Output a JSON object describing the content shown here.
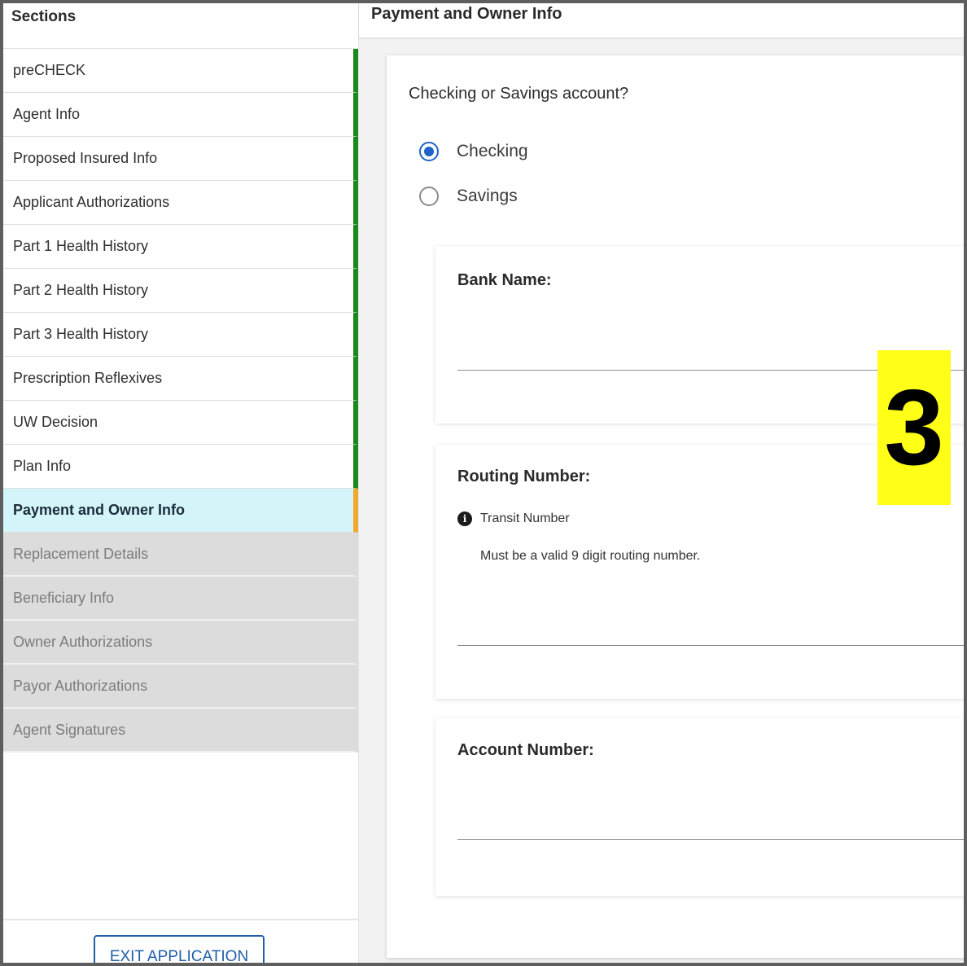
{
  "sidebar": {
    "header": "Sections",
    "items": [
      {
        "label": "preCHECK",
        "state": "complete"
      },
      {
        "label": "Agent Info",
        "state": "complete"
      },
      {
        "label": "Proposed Insured Info",
        "state": "complete"
      },
      {
        "label": "Applicant Authorizations",
        "state": "complete"
      },
      {
        "label": "Part 1 Health History",
        "state": "complete"
      },
      {
        "label": "Part 2 Health History",
        "state": "complete"
      },
      {
        "label": "Part 3 Health History",
        "state": "complete"
      },
      {
        "label": "Prescription Reflexives",
        "state": "complete"
      },
      {
        "label": "UW Decision",
        "state": "complete"
      },
      {
        "label": "Plan Info",
        "state": "complete"
      },
      {
        "label": "Payment and Owner Info",
        "state": "active"
      },
      {
        "label": "Replacement Details",
        "state": "locked"
      },
      {
        "label": "Beneficiary Info",
        "state": "locked"
      },
      {
        "label": "Owner Authorizations",
        "state": "locked"
      },
      {
        "label": "Payor Authorizations",
        "state": "locked"
      },
      {
        "label": "Agent Signatures",
        "state": "locked"
      }
    ],
    "exit_button": "EXIT APPLICATION"
  },
  "main": {
    "title": "Payment and Owner Info",
    "account_type": {
      "question": "Checking or Savings account?",
      "options": [
        {
          "label": "Checking",
          "selected": true
        },
        {
          "label": "Savings",
          "selected": false
        }
      ]
    },
    "fields": {
      "bank_name": {
        "label": "Bank Name:",
        "value": ""
      },
      "routing_number": {
        "label": "Routing Number:",
        "info_label": "Transit Number",
        "hint": "Must be a valid 9 digit routing number.",
        "value": ""
      },
      "account_number": {
        "label": "Account Number:",
        "value": ""
      }
    }
  },
  "overlay": {
    "step_number": "3"
  },
  "colors": {
    "complete_marker": "#1a8a1a",
    "active_marker": "#f0a92e",
    "active_bg": "#d3f4f9",
    "locked_bg": "#dcdcdc",
    "accent_blue": "#1e63c7",
    "badge_yellow": "#ffff17"
  },
  "icons": {
    "info": "info-icon"
  }
}
